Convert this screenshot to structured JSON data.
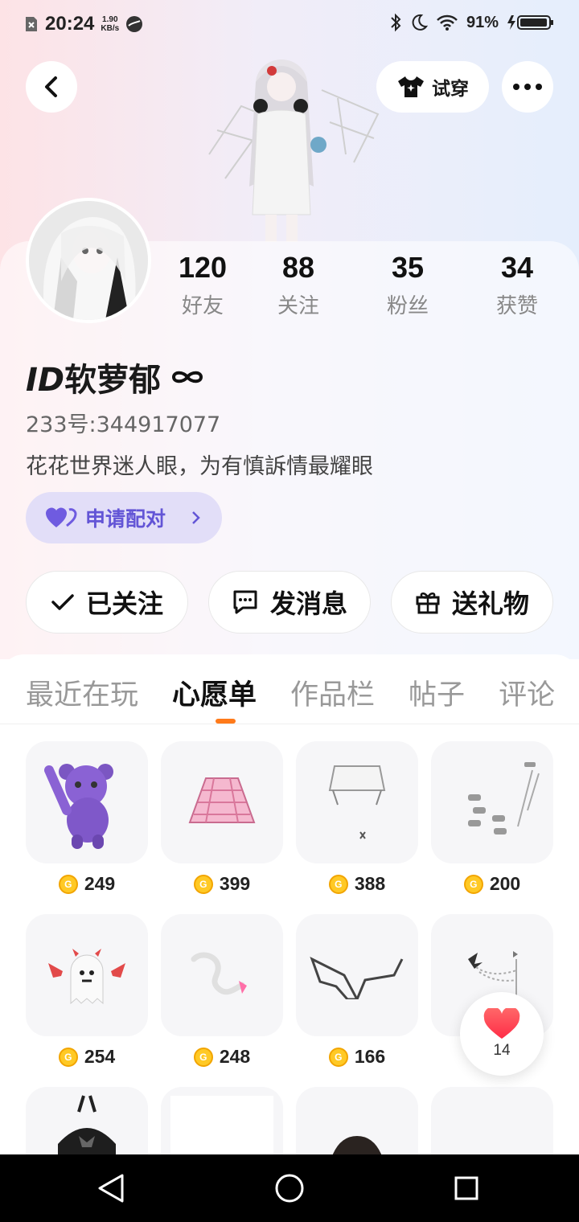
{
  "status_bar": {
    "time": "20:24",
    "net_speed_value": "1.90",
    "net_speed_unit": "KB/s",
    "battery": "91%"
  },
  "header": {
    "try_on_label": "试穿"
  },
  "profile": {
    "stats": [
      {
        "value": "120",
        "label": "好友"
      },
      {
        "value": "88",
        "label": "关注"
      },
      {
        "value": "35",
        "label": "粉丝"
      },
      {
        "value": "34",
        "label": "获赞"
      }
    ],
    "name_prefix": "ID",
    "name": "软萝郁",
    "uid": "233号:344917077",
    "bio": "花花世界迷人眼，为有慎訴情最耀眼",
    "pair_label": "申请配对"
  },
  "actions": {
    "follow_label": "已关注",
    "message_label": "发消息",
    "gift_label": "送礼物"
  },
  "tabs": [
    "最近在玩",
    "心愿单",
    "作品栏",
    "帖子",
    "评论"
  ],
  "active_tab": "心愿单",
  "wishlist": [
    {
      "icon": "purple-bear",
      "price": "249"
    },
    {
      "icon": "pink-skirt",
      "price": "399"
    },
    {
      "icon": "white-shorts",
      "price": "388"
    },
    {
      "icon": "hair-clips",
      "price": "200"
    },
    {
      "icon": "devil-ghost",
      "price": "254"
    },
    {
      "icon": "white-tail",
      "price": "248"
    },
    {
      "icon": "glasses",
      "price": "166"
    },
    {
      "icon": "butterfly-chain",
      "price": ""
    },
    {
      "icon": "black-bag",
      "price": ""
    },
    {
      "icon": "white-item",
      "price": ""
    },
    {
      "icon": "dark-hair",
      "price": ""
    },
    {
      "icon": "purple-cat-hood",
      "price": ""
    }
  ],
  "floating_like": {
    "count": "14"
  },
  "colors": {
    "accent_orange": "#ff7a1a",
    "pair_purple": "#6355d6",
    "coin_gold": "#ffc925",
    "like_red": "#ff3b4a"
  }
}
